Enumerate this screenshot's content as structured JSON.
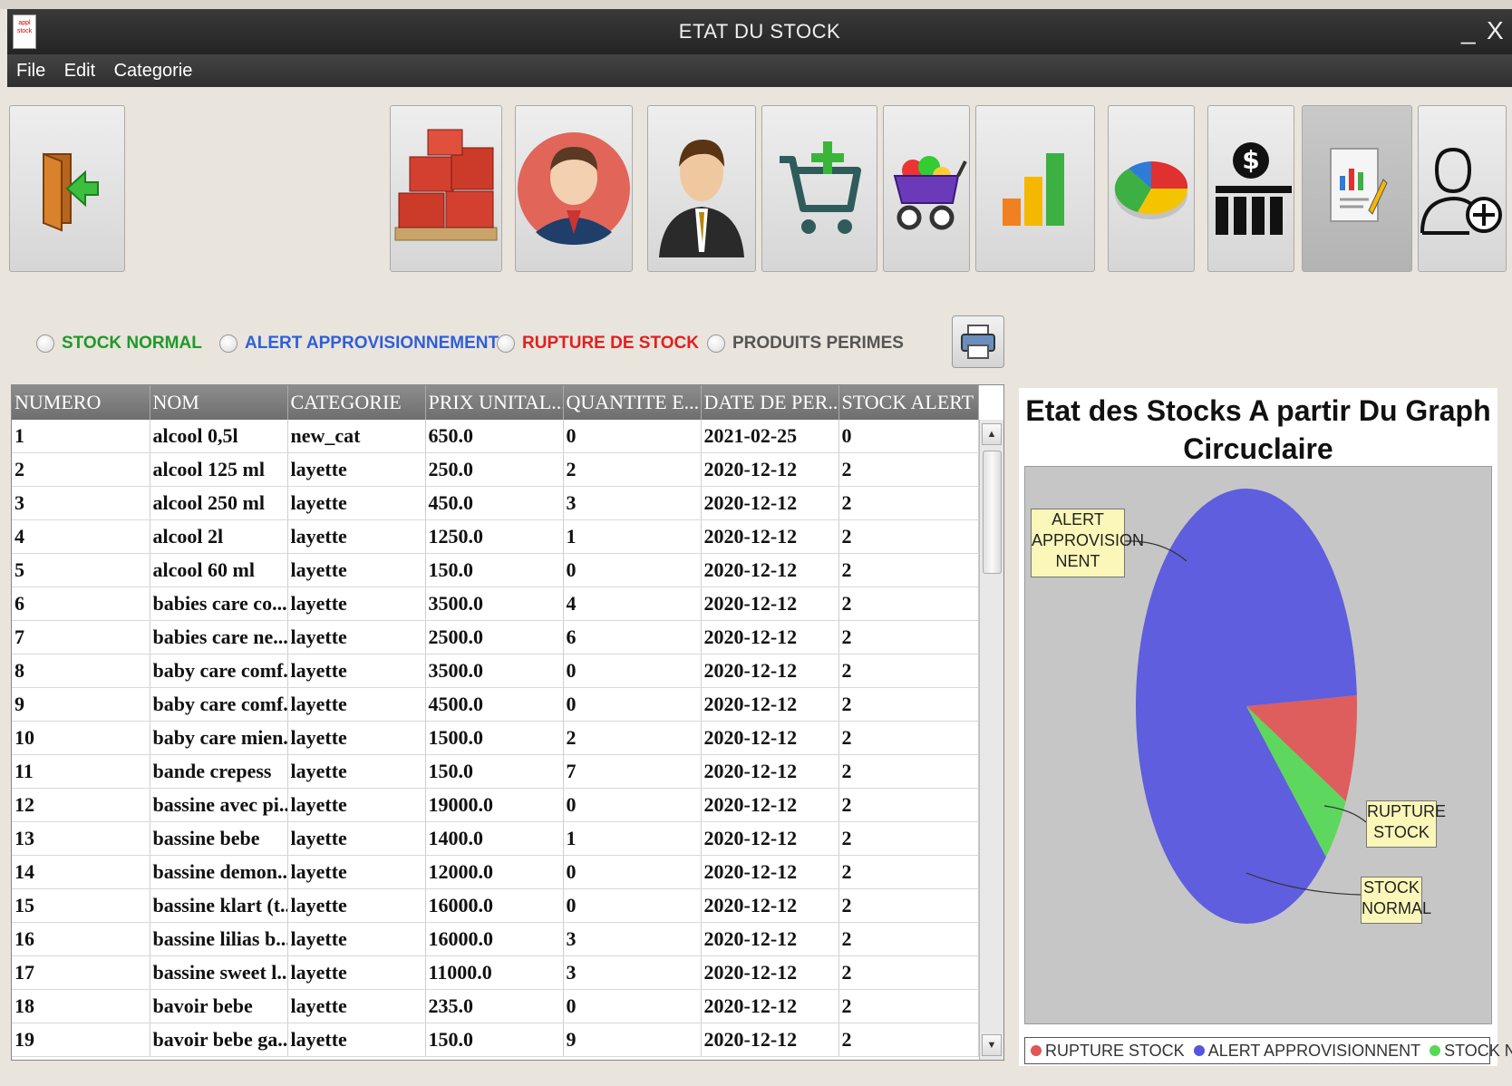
{
  "window": {
    "title": "ETAT DU STOCK",
    "app_icon_text": "appl stock",
    "minimize": "_",
    "close": "X"
  },
  "menu": [
    "File",
    "Edit",
    "Categorie"
  ],
  "toolbar": {
    "exit_icon": "exit-door-icon",
    "items": [
      "boxes-icon",
      "user-avatar-icon",
      "businessman-icon",
      "cart-add-icon",
      "shopping-cart-icon",
      "bar-chart-icon",
      "pie-chart-icon",
      "money-chart-icon",
      "report-icon",
      "add-user-icon"
    ]
  },
  "filters": {
    "normal": {
      "label": "STOCK NORMAL",
      "color": "#1e9a2a"
    },
    "alert": {
      "label": "ALERT APPROVISIONNEMENT",
      "color": "#2f5fd8"
    },
    "rupture": {
      "label": "RUPTURE DE STOCK",
      "color": "#e02020"
    },
    "perimes": {
      "label": "PRODUITS PERIMES",
      "color": "#555555"
    }
  },
  "table": {
    "columns": [
      "NUMERO",
      "NOM",
      "CATEGORIE",
      "PRIX UNITAL...",
      "QUANTITE E...",
      "DATE DE PER...",
      "STOCK ALERT"
    ],
    "rows": [
      [
        "1",
        "alcool 0,5l",
        "new_cat",
        "650.0",
        "0",
        "2021-02-25",
        "0"
      ],
      [
        "2",
        "alcool 125 ml",
        "layette",
        "250.0",
        "2",
        "2020-12-12",
        "2"
      ],
      [
        "3",
        "alcool 250 ml",
        "layette",
        "450.0",
        "3",
        "2020-12-12",
        "2"
      ],
      [
        "4",
        "alcool 2l",
        "layette",
        "1250.0",
        "1",
        "2020-12-12",
        "2"
      ],
      [
        "5",
        "alcool 60 ml",
        "layette",
        "150.0",
        "0",
        "2020-12-12",
        "2"
      ],
      [
        "6",
        "babies care co...",
        "layette",
        "3500.0",
        "4",
        "2020-12-12",
        "2"
      ],
      [
        "7",
        "babies care ne...",
        "layette",
        "2500.0",
        "6",
        "2020-12-12",
        "2"
      ],
      [
        "8",
        "baby care comf...",
        "layette",
        "3500.0",
        "0",
        "2020-12-12",
        "2"
      ],
      [
        "9",
        "baby care comf...",
        "layette",
        "4500.0",
        "0",
        "2020-12-12",
        "2"
      ],
      [
        "10",
        "baby care mien...",
        "layette",
        "1500.0",
        "2",
        "2020-12-12",
        "2"
      ],
      [
        "11",
        "bande crepess",
        "layette",
        "150.0",
        "7",
        "2020-12-12",
        "2"
      ],
      [
        "12",
        "bassine avec pi...",
        "layette",
        "19000.0",
        "0",
        "2020-12-12",
        "2"
      ],
      [
        "13",
        "bassine bebe",
        "layette",
        "1400.0",
        "1",
        "2020-12-12",
        "2"
      ],
      [
        "14",
        "bassine demon...",
        "layette",
        "12000.0",
        "0",
        "2020-12-12",
        "2"
      ],
      [
        "15",
        "bassine klart (t...",
        "layette",
        "16000.0",
        "0",
        "2020-12-12",
        "2"
      ],
      [
        "16",
        "bassine lilias b...",
        "layette",
        "16000.0",
        "3",
        "2020-12-12",
        "2"
      ],
      [
        "17",
        "bassine sweet l...",
        "layette",
        "11000.0",
        "3",
        "2020-12-12",
        "2"
      ],
      [
        "18",
        "bavoir bebe",
        "layette",
        "235.0",
        "0",
        "2020-12-12",
        "2"
      ],
      [
        "19",
        "bavoir bebe ga...",
        "layette",
        "150.0",
        "9",
        "2020-12-12",
        "2"
      ]
    ]
  },
  "chart": {
    "title_line1": "Etat des Stocks A partir Du Graph",
    "title_line2": "Circuclaire",
    "callouts": {
      "alert": [
        "ALERT",
        "APPROVISION",
        "NENT"
      ],
      "rupture": [
        "RUPTURE",
        "STOCK"
      ],
      "normal": [
        "STOCK",
        "NORMAL"
      ]
    },
    "legend": [
      {
        "label": "RUPTURE STOCK",
        "color": "#e05555"
      },
      {
        "label": "ALERT APPROVISIONNENT",
        "color": "#5555e0"
      },
      {
        "label": "STOCK NORMAL",
        "color": "#55d855"
      }
    ]
  },
  "chart_data": {
    "type": "pie",
    "categories": [
      "RUPTURE STOCK",
      "ALERT APPROVISIONNENT",
      "STOCK NORMAL"
    ],
    "values": [
      8,
      87,
      5
    ]
  }
}
